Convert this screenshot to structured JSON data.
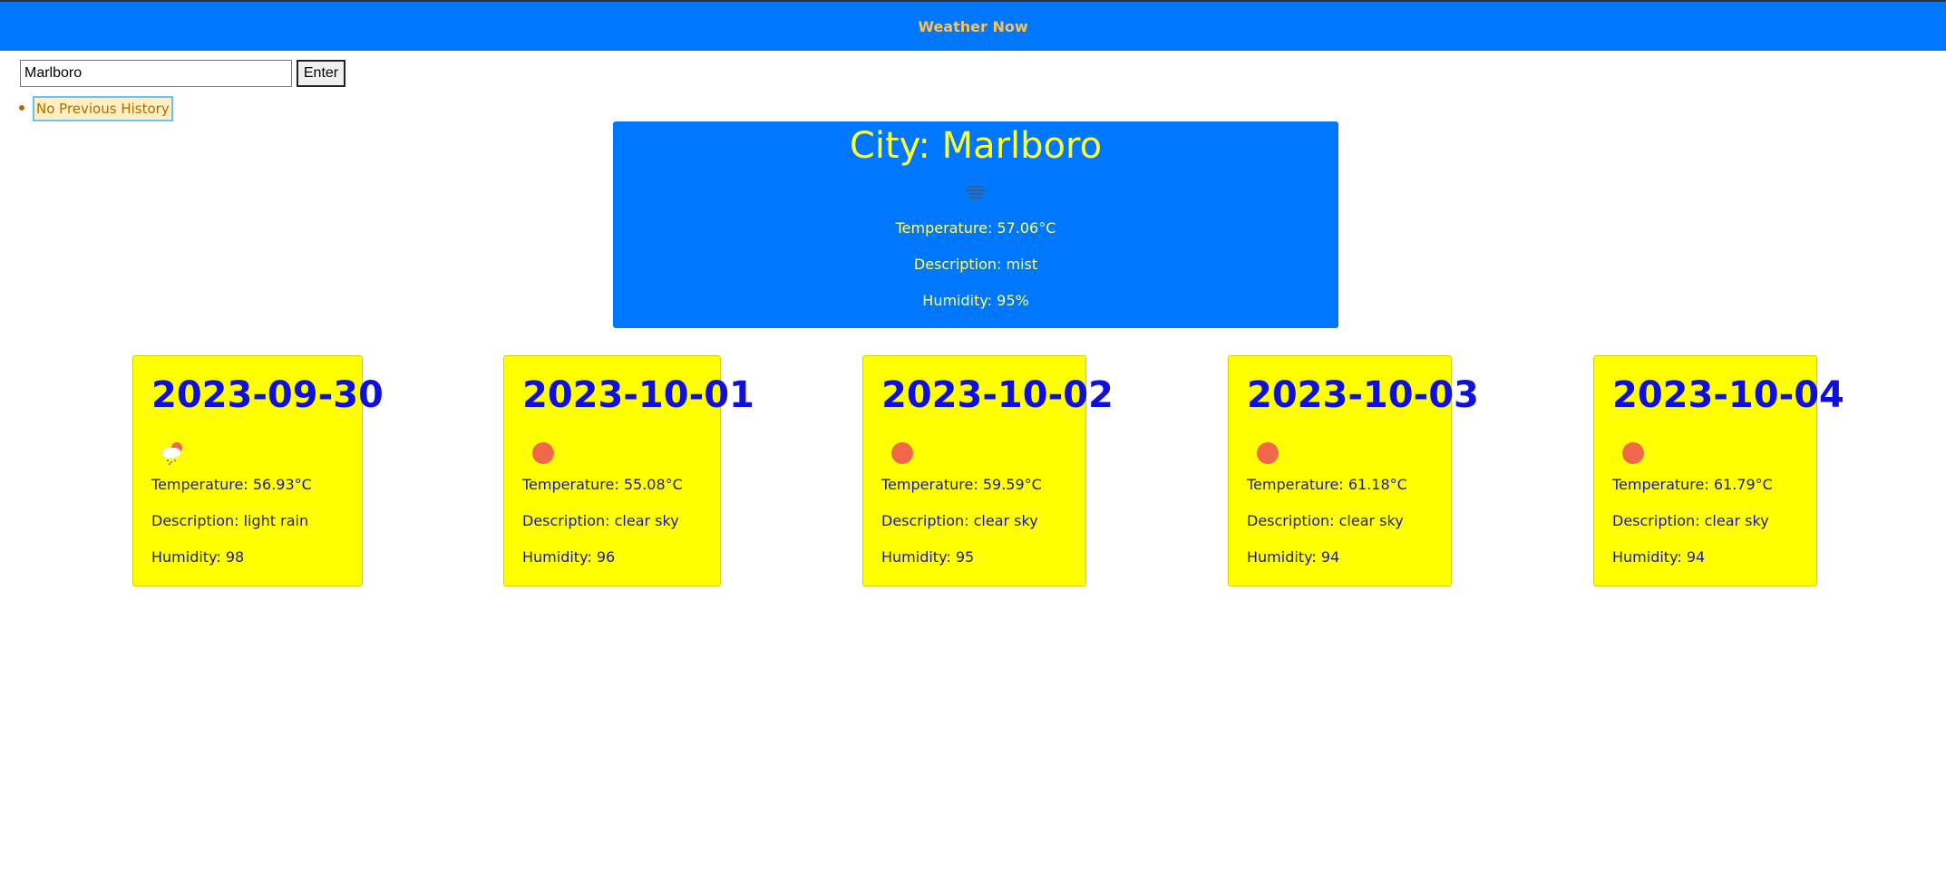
{
  "header": {
    "title": "Weather Now",
    "background_color": "#0077ff",
    "title_color": "#ffc24a"
  },
  "search": {
    "value": "Marlboro",
    "placeholder": "",
    "enter_label": "Enter"
  },
  "history": {
    "items": [
      {
        "label": "No Previous History"
      }
    ]
  },
  "current": {
    "city_label": "City: Marlboro",
    "icon": "mist-icon",
    "temperature": "Temperature: 57.06°C",
    "description": "Description: mist",
    "humidity": "Humidity: 95%",
    "background_color": "#0077ff",
    "text_color": "#ffff33"
  },
  "forecast": {
    "card_color": "#ffff00",
    "text_color": "#1010c8",
    "days": [
      {
        "date": "2023-09-30",
        "icon": "light-rain-icon",
        "temperature": "Temperature: 56.93°C",
        "description": "Description: light rain",
        "humidity": "Humidity: 98"
      },
      {
        "date": "2023-10-01",
        "icon": "clear-sky-icon",
        "temperature": "Temperature: 55.08°C",
        "description": "Description: clear sky",
        "humidity": "Humidity: 96"
      },
      {
        "date": "2023-10-02",
        "icon": "clear-sky-icon",
        "temperature": "Temperature: 59.59°C",
        "description": "Description: clear sky",
        "humidity": "Humidity: 95"
      },
      {
        "date": "2023-10-03",
        "icon": "clear-sky-icon",
        "temperature": "Temperature: 61.18°C",
        "description": "Description: clear sky",
        "humidity": "Humidity: 94"
      },
      {
        "date": "2023-10-04",
        "icon": "clear-sky-icon",
        "temperature": "Temperature: 61.79°C",
        "description": "Description: clear sky",
        "humidity": "Humidity: 94"
      }
    ]
  }
}
